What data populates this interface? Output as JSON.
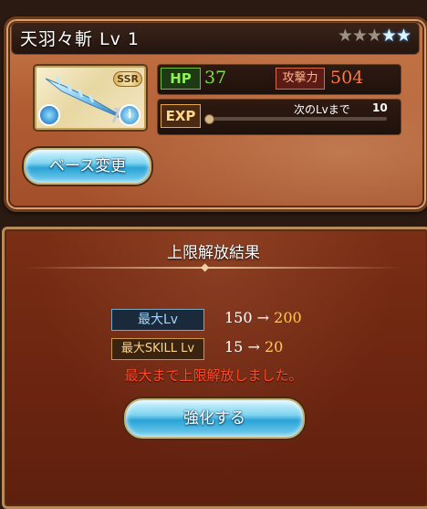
{
  "card": {
    "title": "天羽々斬 Lv 1",
    "stars_bronze": "★★★",
    "stars_blue": "★★",
    "rarity": "SSR",
    "hp_label": "HP",
    "hp_value": "37",
    "atk_label": "攻撃力",
    "atk_value": "504",
    "exp_label": "EXP",
    "next_label": "次のLvまで",
    "next_value": "10",
    "exp_progress": 0.0,
    "base_change_label": "ベース変更"
  },
  "result": {
    "title": "上限解放結果",
    "max_lv_label": "最大Lv",
    "max_lv_from": "150",
    "max_lv_to": "200",
    "skill_lv_label": "最大SKILL Lv",
    "skill_lv_from": "15",
    "skill_lv_to": "20",
    "arrow": "→",
    "message": "最大まで上限解放しました。",
    "enhance_label": "強化する"
  }
}
